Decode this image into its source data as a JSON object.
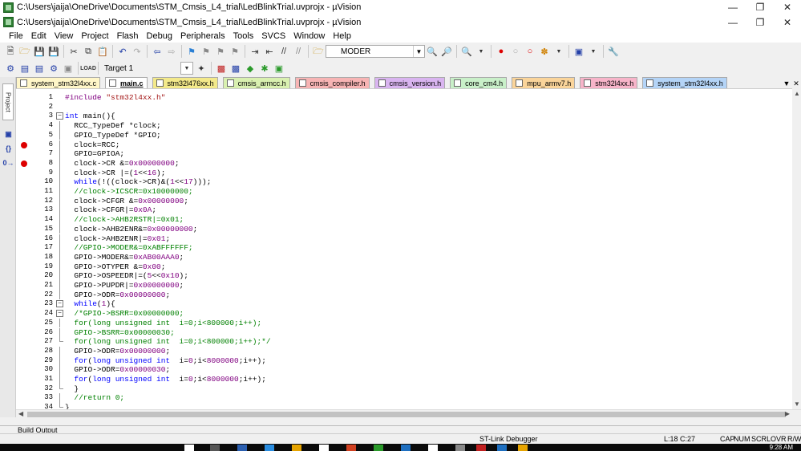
{
  "window": {
    "title_outer": "C:\\Users\\jaija\\OneDrive\\Documents\\STM_Cmsis_L4_trial\\LedBlinkTrial.uvprojx - µVision",
    "title_inner": "C:\\Users\\jaija\\OneDrive\\Documents\\STM_Cmsis_L4_trial\\LedBlinkTrial.uvprojx - µVision"
  },
  "menu": [
    "File",
    "Edit",
    "View",
    "Project",
    "Flash",
    "Debug",
    "Peripherals",
    "Tools",
    "SVCS",
    "Window",
    "Help"
  ],
  "toolbar": {
    "find_combo": "MODER",
    "target_combo": "Target 1"
  },
  "left_panel": {
    "project_label": "Project"
  },
  "tabs": [
    {
      "label": "system_stm32l4xx.c",
      "color": "#fff6c8",
      "active": false
    },
    {
      "label": "main.c",
      "color": "#ffffff",
      "active": true
    },
    {
      "label": "stm32l476xx.h",
      "color": "#f3e98a",
      "active": false
    },
    {
      "label": "cmsis_armcc.h",
      "color": "#d9f0b0",
      "active": false
    },
    {
      "label": "cmsis_compiler.h",
      "color": "#f7b4b4",
      "active": false
    },
    {
      "label": "cmsis_version.h",
      "color": "#d9b4f0",
      "active": false
    },
    {
      "label": "core_cm4.h",
      "color": "#c9f0c9",
      "active": false
    },
    {
      "label": "mpu_armv7.h",
      "color": "#fad49a",
      "active": false
    },
    {
      "label": "stm32l4xx.h",
      "color": "#f7b4c9",
      "active": false
    },
    {
      "label": "system_stm32l4xx.h",
      "color": "#b4d4f7",
      "active": false
    }
  ],
  "code_lines": [
    {
      "n": "1",
      "html": "<span class='c-pp'>#include</span> <span class='c-str'>\"stm32l4xx.h\"</span>",
      "bp": false,
      "fold": ""
    },
    {
      "n": "2",
      "html": "",
      "bp": false,
      "fold": ""
    },
    {
      "n": "3",
      "html": "<span class='c-kw'>int</span> main(){",
      "bp": false,
      "fold": "open"
    },
    {
      "n": "4",
      "html": "  RCC_TypeDef *clock;",
      "bp": false,
      "fold": "line"
    },
    {
      "n": "5",
      "html": "  GPIO_TypeDef *GPIO;",
      "bp": false,
      "fold": "line"
    },
    {
      "n": "6",
      "html": "  clock=RCC;",
      "bp": true,
      "fold": "line"
    },
    {
      "n": "7",
      "html": "  GPIO=GPIOA;",
      "bp": false,
      "fold": "line"
    },
    {
      "n": "8",
      "html": "  clock-&gt;CR &amp;=<span class='c-num'>0x00000000</span>;",
      "bp": true,
      "fold": "line"
    },
    {
      "n": "9",
      "html": "  clock-&gt;CR |=(<span class='c-num'>1</span>&lt;&lt;<span class='c-num'>16</span>);",
      "bp": false,
      "fold": "line"
    },
    {
      "n": "10",
      "html": "  <span class='c-kw'>while</span>(!((clock-&gt;CR)&amp;(<span class='c-num'>1</span>&lt;&lt;<span class='c-num'>17</span>)));",
      "bp": false,
      "fold": "line"
    },
    {
      "n": "11",
      "html": "  <span class='c-cm'>//clock-&gt;ICSCR=0x10000000;</span>",
      "bp": false,
      "fold": "line"
    },
    {
      "n": "12",
      "html": "  clock-&gt;CFGR &amp;=<span class='c-num'>0x00000000</span>;",
      "bp": false,
      "fold": "line"
    },
    {
      "n": "13",
      "html": "  clock-&gt;CFGR|=<span class='c-num'>0x0A</span>;",
      "bp": false,
      "fold": "line"
    },
    {
      "n": "14",
      "html": "  <span class='c-cm'>//clock-&gt;AHB2RSTR|=0x01;</span>",
      "bp": false,
      "fold": "line"
    },
    {
      "n": "15",
      "html": "  clock-&gt;AHB2ENR&amp;=<span class='c-num'>0x00000000</span>;",
      "bp": false,
      "fold": "line"
    },
    {
      "n": "16",
      "html": "  clock-&gt;AHB2ENR|=<span class='c-num'>0x01</span>;",
      "bp": false,
      "fold": "line"
    },
    {
      "n": "17",
      "html": "  <span class='c-cm'>//GPIO-&gt;MODER&amp;=0xABFFFFFF;</span>",
      "bp": false,
      "fold": "line"
    },
    {
      "n": "18",
      "html": "  GPIO-&gt;MODER&amp;=<span class='c-num'>0xAB00AAA0</span>;",
      "bp": false,
      "fold": "line"
    },
    {
      "n": "19",
      "html": "  GPIO-&gt;OTYPER &amp;=<span class='c-num'>0x00</span>;",
      "bp": false,
      "fold": "line"
    },
    {
      "n": "20",
      "html": "  GPIO-&gt;OSPEEDR|=(<span class='c-num'>5</span>&lt;&lt;<span class='c-num'>0x10</span>);",
      "bp": false,
      "fold": "line"
    },
    {
      "n": "21",
      "html": "  GPIO-&gt;PUPDR|=<span class='c-num'>0x00000000</span>;",
      "bp": false,
      "fold": "line"
    },
    {
      "n": "22",
      "html": "  GPIO-&gt;ODR=<span class='c-num'>0x00000000</span>;",
      "bp": false,
      "fold": "line"
    },
    {
      "n": "23",
      "html": "  <span class='c-kw'>while</span>(<span class='c-num'>1</span>){",
      "bp": false,
      "fold": "open"
    },
    {
      "n": "24",
      "html": "  <span class='c-cm'>/*GPIO-&gt;BSRR=0x00000000;</span>",
      "bp": false,
      "fold": "open"
    },
    {
      "n": "25",
      "html": "  <span class='c-cm'>for(long unsigned int  i=0;i&lt;800000;i++);</span>",
      "bp": false,
      "fold": "line"
    },
    {
      "n": "26",
      "html": "  <span class='c-cm'>GPIO-&gt;BSRR=0x00000030;</span>",
      "bp": false,
      "fold": "line"
    },
    {
      "n": "27",
      "html": "  <span class='c-cm'>for(long unsigned int  i=0;i&lt;800000;i++);*/</span>",
      "bp": false,
      "fold": "end"
    },
    {
      "n": "28",
      "html": "  GPIO-&gt;ODR=<span class='c-num'>0x00000000</span>;",
      "bp": false,
      "fold": "line"
    },
    {
      "n": "29",
      "html": "  <span class='c-kw'>for</span>(<span class='c-kw'>long unsigned int</span>  i=<span class='c-num'>0</span>;i&lt;<span class='c-num'>8000000</span>;i++);",
      "bp": false,
      "fold": "line"
    },
    {
      "n": "30",
      "html": "  GPIO-&gt;ODR=<span class='c-num'>0x00000030</span>;",
      "bp": false,
      "fold": "line"
    },
    {
      "n": "31",
      "html": "  <span class='c-kw'>for</span>(<span class='c-kw'>long unsigned int</span>  i=<span class='c-num'>0</span>;i&lt;<span class='c-num'>8000000</span>;i++);",
      "bp": false,
      "fold": "line"
    },
    {
      "n": "32",
      "html": "  }",
      "bp": false,
      "fold": "end"
    },
    {
      "n": "33",
      "html": "  <span class='c-cm'>//return 0;</span>",
      "bp": false,
      "fold": "line"
    },
    {
      "n": "34",
      "html": "}",
      "bp": false,
      "fold": "end"
    }
  ],
  "build_output": {
    "label": "Build Output"
  },
  "status": {
    "debugger": "ST-Link Debugger",
    "cursor": "L:18 C:27",
    "caps": "CAP",
    "num": "NUM",
    "scrl": "SCRL",
    "ovr": "OVR",
    "rw": "R/W"
  },
  "taskbar": {
    "time": "9:28 AM"
  }
}
